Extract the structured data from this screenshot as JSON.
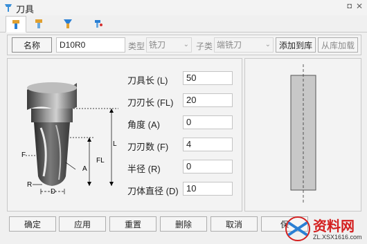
{
  "window": {
    "title": "刀具"
  },
  "tabs": [
    {
      "name": "tool-tab",
      "active": true
    },
    {
      "name": "holder-tab",
      "active": false
    },
    {
      "name": "shank-tab",
      "active": false
    },
    {
      "name": "spray-tab",
      "active": false
    }
  ],
  "toolbar": {
    "name_button": "名称",
    "name_value": "D10R0",
    "type_label": "类型",
    "type_value": "铣刀",
    "subtype_label": "子类",
    "subtype_value": "端铣刀",
    "add_to_library": "添加到库",
    "load_from_library": "从库加载"
  },
  "params": [
    {
      "label": "刀具长 (L)",
      "value": "50"
    },
    {
      "label": "刀刃长 (FL)",
      "value": "20"
    },
    {
      "label": "角度 (A)",
      "value": "0"
    },
    {
      "label": "刀刃数 (F)",
      "value": "4"
    },
    {
      "label": "半径 (R)",
      "value": "0"
    },
    {
      "label": "刀体直径 (D)",
      "value": "10"
    }
  ],
  "diagram": {
    "labels": {
      "L": "L",
      "FL": "FL",
      "A": "A",
      "F": "F",
      "R": "R",
      "D": "D"
    }
  },
  "buttons": {
    "ok": "确定",
    "apply": "应用",
    "reset": "重置",
    "delete": "删除",
    "cancel": "取消",
    "save": "保"
  },
  "watermark": {
    "text": "资料网",
    "url": "ZL.XSX1616.com"
  },
  "colors": {
    "accent_blue": "#2a7fd4",
    "watermark_red": "#d42020",
    "preview_fill": "#c8c8c8"
  }
}
